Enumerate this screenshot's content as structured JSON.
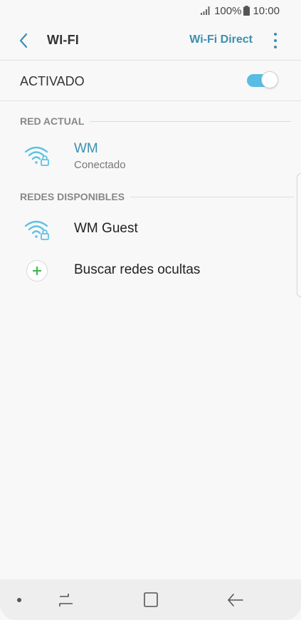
{
  "status_bar": {
    "signal_icon": "signal-bars-icon",
    "battery_percent": "100%",
    "battery_icon": "battery-full-icon",
    "time": "10:00"
  },
  "app_bar": {
    "back_icon": "chevron-left-icon",
    "title": "WI-FI",
    "wifi_direct_label": "Wi-Fi Direct",
    "more_icon": "more-vertical-icon"
  },
  "wifi_toggle": {
    "label": "ACTIVADO",
    "state": "on",
    "accent_color": "#57bde5"
  },
  "current_network": {
    "header": "RED ACTUAL",
    "name": "WM",
    "status": "Conectado",
    "icon": "wifi-locked-icon",
    "name_color": "#3b8fb0"
  },
  "available_networks": {
    "header": "REDES DISPONIBLES",
    "items": [
      {
        "name": "WM Guest",
        "icon": "wifi-locked-icon"
      }
    ],
    "hidden_networks_label": "Buscar redes ocultas",
    "hidden_networks_icon": "plus-icon"
  },
  "nav_bar": {
    "dot_icon": "dot-icon",
    "recents_icon": "recents-icon",
    "home_icon": "home-square-icon",
    "back_icon": "back-arrow-icon"
  }
}
